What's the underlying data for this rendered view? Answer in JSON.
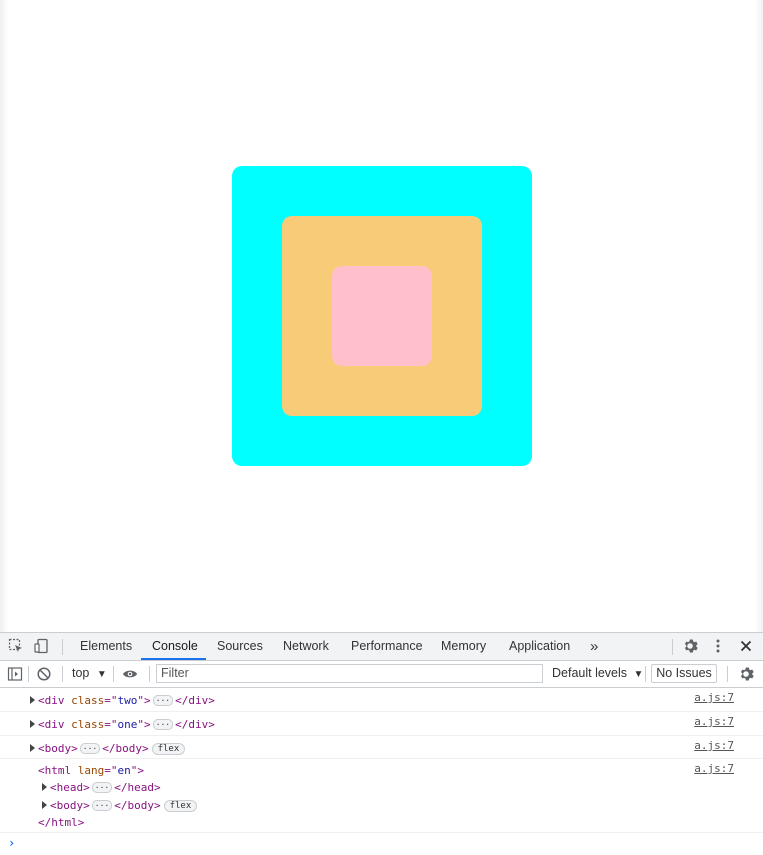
{
  "page": {
    "colors": {
      "outer_box": "#00ffff",
      "middle_box": "#f7cb77",
      "inner_box": "#ffc0cb"
    }
  },
  "devtools": {
    "tabs": [
      "Elements",
      "Console",
      "Sources",
      "Network",
      "Performance",
      "Memory",
      "Application"
    ],
    "active_tab": "Console",
    "more_tabs_glyph": "»",
    "icons": {
      "inspect": "inspect-element-icon",
      "device": "device-toolbar-icon",
      "settings": "gear-icon",
      "menu": "kebab-menu-icon",
      "close": "close-icon",
      "sidebar": "console-sidebar-icon",
      "clear": "clear-console-icon",
      "eye": "live-expression-icon"
    },
    "toolbar": {
      "context": "top",
      "filter_placeholder": "Filter",
      "levels": "Default levels",
      "issues": "No Issues"
    },
    "console": {
      "rows": [
        {
          "tag": "div",
          "attr": "class",
          "value": "two",
          "source": "a.js:7"
        },
        {
          "tag": "div",
          "attr": "class",
          "value": "one",
          "source": "a.js:7"
        },
        {
          "tag": "body",
          "badge": "flex",
          "source": "a.js:7"
        }
      ],
      "expanded": {
        "source": "a.js:7",
        "open_tag": "html",
        "attr": "lang",
        "value": "en",
        "children": [
          {
            "tag": "head"
          },
          {
            "tag": "body",
            "badge": "flex"
          }
        ],
        "close_tag": "html"
      },
      "prompt": "›"
    }
  }
}
